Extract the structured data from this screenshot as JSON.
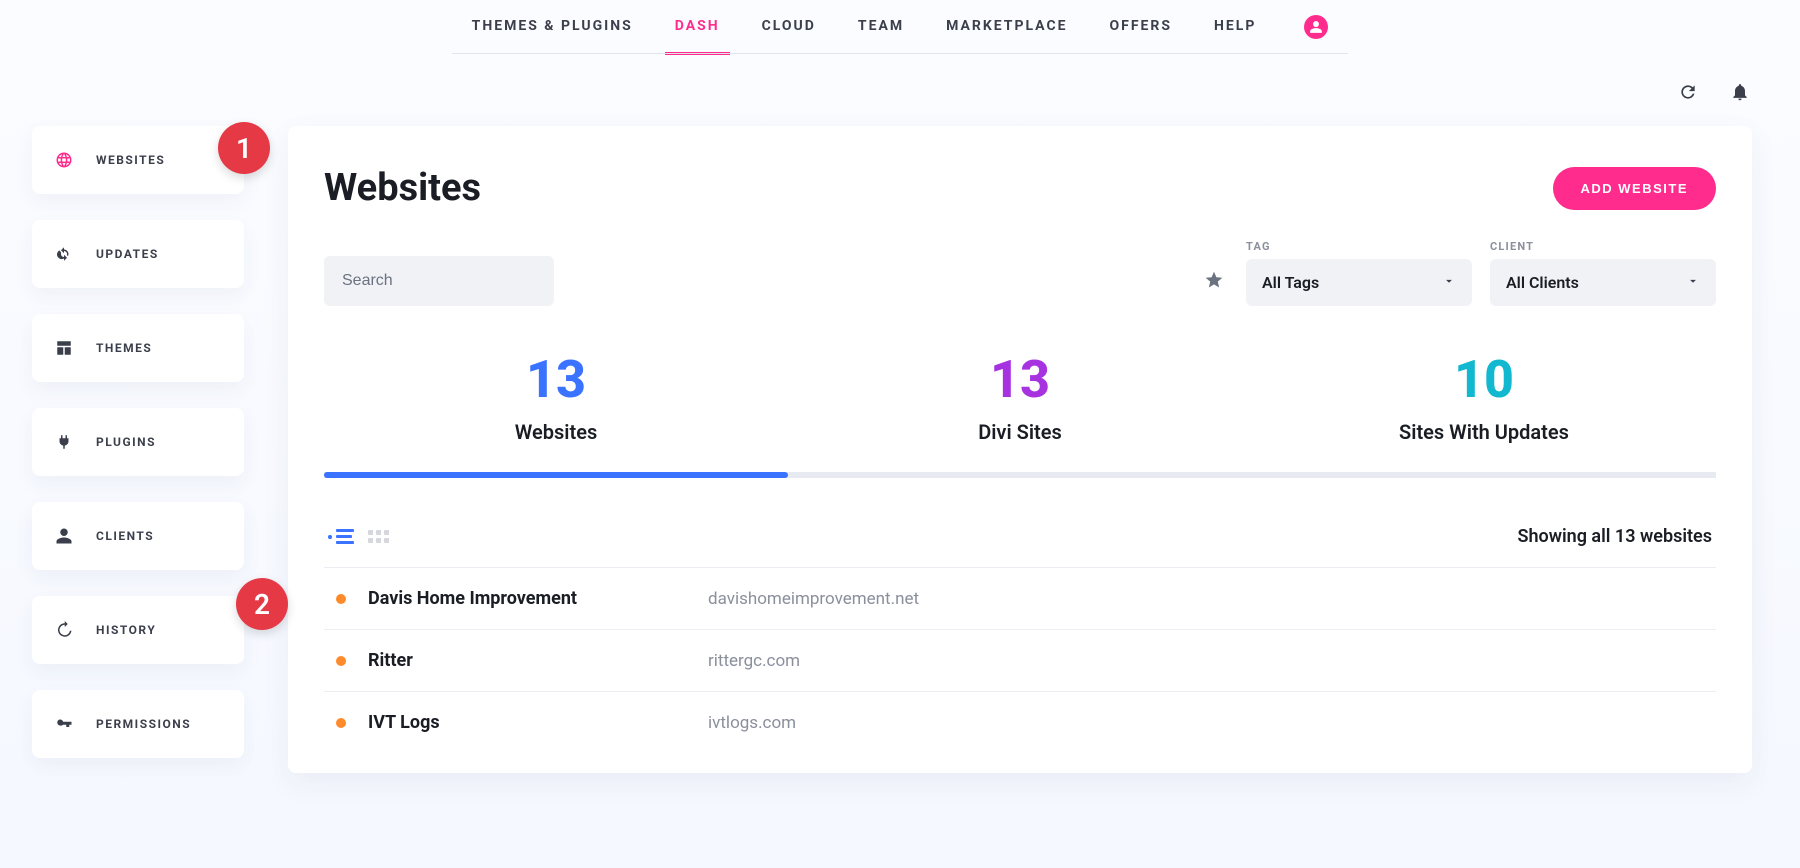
{
  "topnav": {
    "items": [
      {
        "label": "THEMES & PLUGINS",
        "active": false
      },
      {
        "label": "DASH",
        "active": true
      },
      {
        "label": "CLOUD",
        "active": false
      },
      {
        "label": "TEAM",
        "active": false
      },
      {
        "label": "MARKETPLACE",
        "active": false
      },
      {
        "label": "OFFERS",
        "active": false
      },
      {
        "label": "HELP",
        "active": false
      }
    ]
  },
  "sidebar": {
    "items": [
      {
        "id": "websites",
        "label": "WEBSITES",
        "active": true
      },
      {
        "id": "updates",
        "label": "UPDATES",
        "active": false
      },
      {
        "id": "themes",
        "label": "THEMES",
        "active": false
      },
      {
        "id": "plugins",
        "label": "PLUGINS",
        "active": false
      },
      {
        "id": "clients",
        "label": "CLIENTS",
        "active": false
      },
      {
        "id": "history",
        "label": "HISTORY",
        "active": false
      },
      {
        "id": "permissions",
        "label": "PERMISSIONS",
        "active": false
      }
    ]
  },
  "callouts": {
    "one": "1",
    "two": "2"
  },
  "panel": {
    "title": "Websites",
    "add_button": "ADD WEBSITE"
  },
  "filters": {
    "search_placeholder": "Search",
    "tag_label": "TAG",
    "tag_value": "All Tags",
    "client_label": "CLIENT",
    "client_value": "All Clients"
  },
  "stats": {
    "websites": {
      "value": "13",
      "label": "Websites"
    },
    "divi": {
      "value": "13",
      "label": "Divi Sites"
    },
    "updates": {
      "value": "10",
      "label": "Sites With Updates"
    }
  },
  "list": {
    "count_text": "Showing all 13 websites",
    "rows": [
      {
        "name": "Davis Home Improvement",
        "domain": "davishomeimprovement.net"
      },
      {
        "name": "Ritter",
        "domain": "rittergc.com"
      },
      {
        "name": "IVT Logs",
        "domain": "ivtlogs.com"
      }
    ]
  }
}
